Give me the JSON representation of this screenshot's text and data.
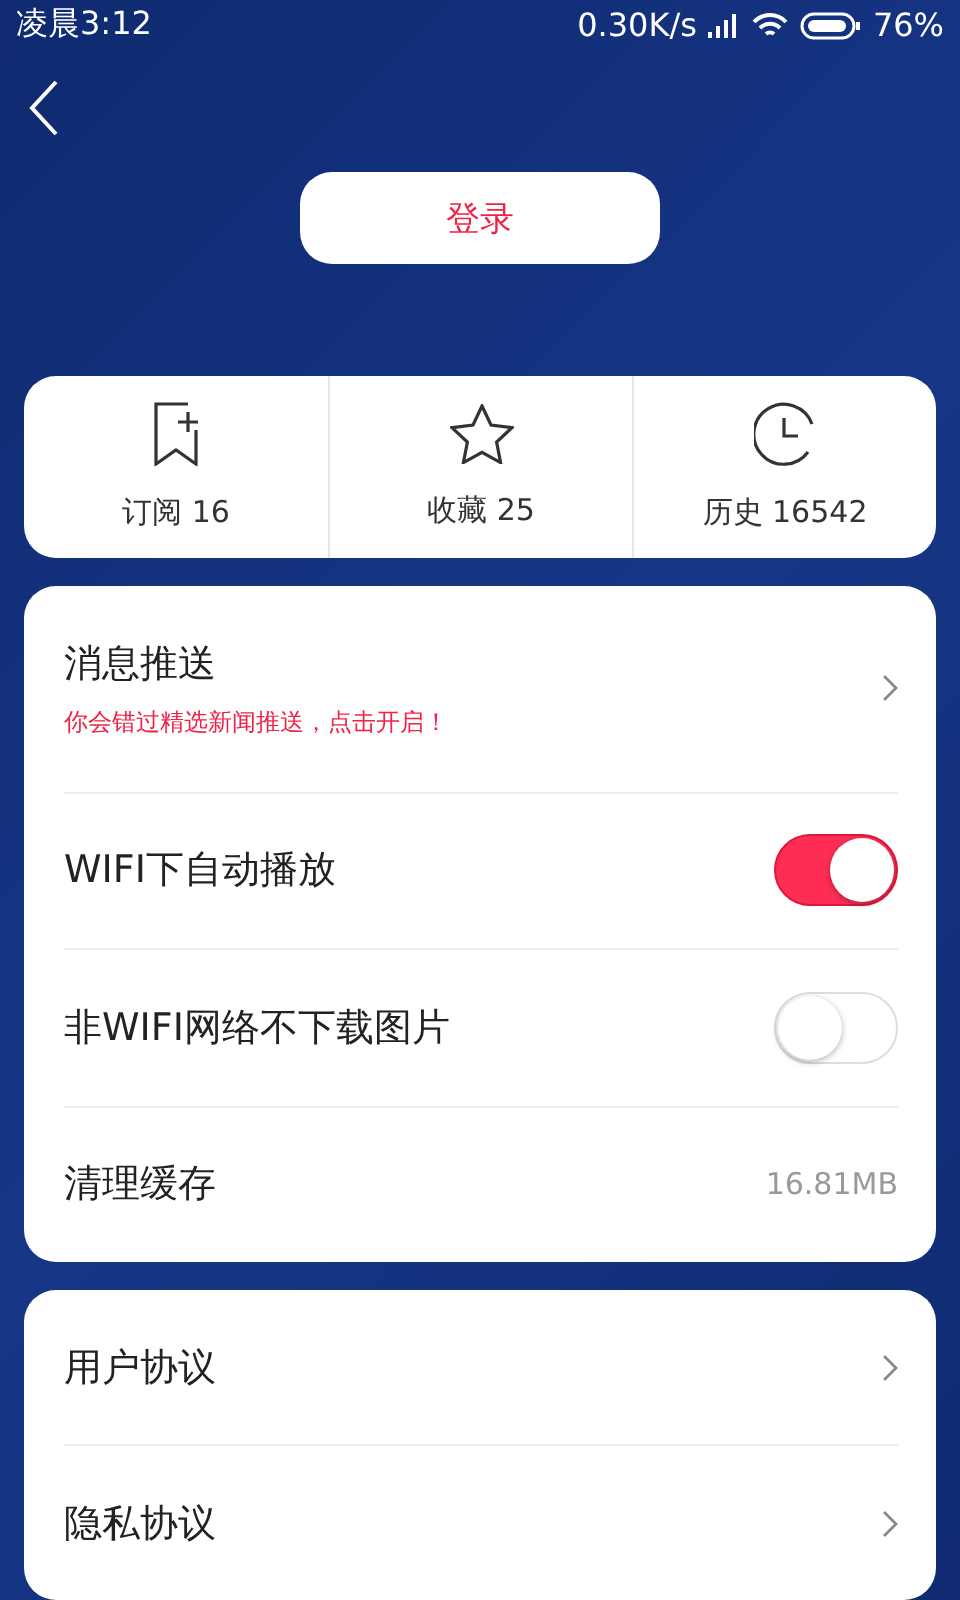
{
  "status_bar": {
    "time": "凌晨3:12",
    "speed": "0.30K/s",
    "battery": "76%"
  },
  "login_button": "登录",
  "stats": [
    {
      "kind": "bookmark",
      "label": "订阅 16"
    },
    {
      "kind": "star",
      "label": "收藏 25"
    },
    {
      "kind": "clock",
      "label": "历史 16542"
    }
  ],
  "settings": [
    {
      "kind": "link",
      "title": "消息推送",
      "subtitle": "你会错过精选新闻推送，点击开启！"
    },
    {
      "kind": "toggle",
      "title": "WIFI下自动播放",
      "on": true
    },
    {
      "kind": "toggle",
      "title": "非WIFI网络不下载图片",
      "on": false
    },
    {
      "kind": "value",
      "title": "清理缓存",
      "value": "16.81MB"
    }
  ],
  "about": [
    {
      "kind": "link",
      "title": "用户协议"
    },
    {
      "kind": "link",
      "title": "隐私协议"
    }
  ]
}
